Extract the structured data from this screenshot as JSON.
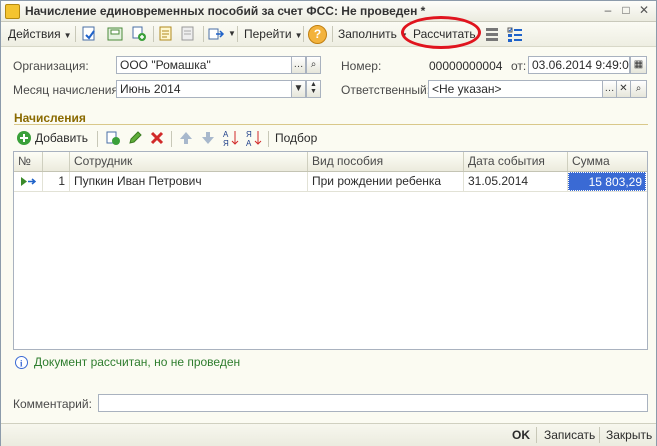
{
  "window": {
    "title": "Начисление единовременных пособий за счет ФСС: Не проведен *",
    "minimize": "–",
    "maximize": "□",
    "close": "✕"
  },
  "toolbar": {
    "actions": "Действия",
    "goto": "Перейти",
    "help": "?",
    "fill": "Заполнить",
    "calculate": "Рассчитать"
  },
  "form": {
    "org_label": "Организация:",
    "org_value": "ООО \"Ромашка\"",
    "number_label": "Номер:",
    "number_value": "00000000004",
    "date_label": "от:",
    "date_value": "03.06.2014  9:49:02",
    "month_label": "Месяц начисления:",
    "month_value": "Июнь 2014",
    "responsible_label": "Ответственный:",
    "responsible_value": "<Не указан>"
  },
  "section": {
    "title": "Начисления",
    "add": "Добавить",
    "pick": "Подбор"
  },
  "table": {
    "headers": [
      "№",
      "Сотрудник",
      "Вид пособия",
      "Дата события",
      "Сумма"
    ],
    "rows": [
      {
        "num": "1",
        "employee": "Пупкин Иван Петрович",
        "type": "При рождении ребенка",
        "date": "31.05.2014",
        "sum": "15 803,29"
      }
    ]
  },
  "info": "Документ рассчитан, но не проведен",
  "comment_label": "Комментарий:",
  "comment_value": "",
  "bottom": {
    "ok": "OK",
    "save": "Записать",
    "close": "Закрыть"
  },
  "colors": {
    "accent_circle": "#e0141e",
    "selection": "#3a6ad4"
  }
}
